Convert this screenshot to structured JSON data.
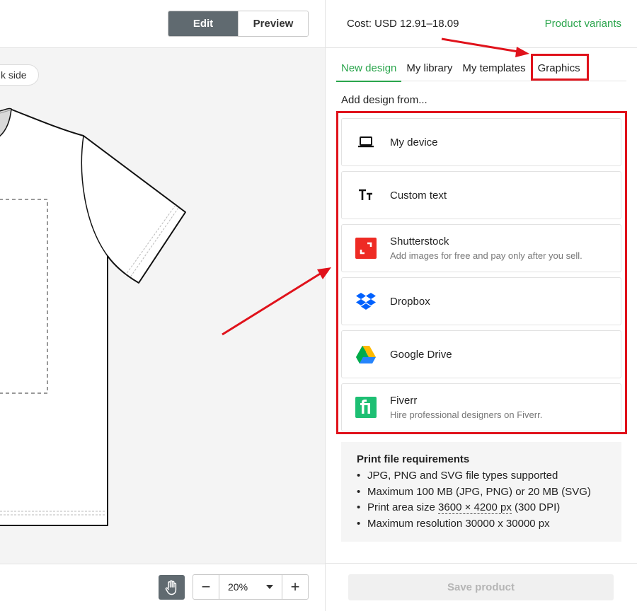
{
  "editor": {
    "edit_label": "Edit",
    "preview_label": "Preview",
    "side_label": "k side"
  },
  "zoom": {
    "minus": "−",
    "value": "20%",
    "plus": "+"
  },
  "header": {
    "cost": "Cost: USD 12.91–18.09",
    "variants_link": "Product variants"
  },
  "tabs": [
    {
      "label": "New design",
      "active": true
    },
    {
      "label": "My library"
    },
    {
      "label": "My templates"
    },
    {
      "label": "Graphics"
    }
  ],
  "add_from_label": "Add design from...",
  "sources": [
    {
      "title": "My device",
      "subtitle": "",
      "icon": "laptop-icon"
    },
    {
      "title": "Custom text",
      "subtitle": "",
      "icon": "text-icon"
    },
    {
      "title": "Shutterstock",
      "subtitle": "Add images for free and pay only after you sell.",
      "icon": "shutterstock-icon"
    },
    {
      "title": "Dropbox",
      "subtitle": "",
      "icon": "dropbox-icon"
    },
    {
      "title": "Google Drive",
      "subtitle": "",
      "icon": "google-drive-icon"
    },
    {
      "title": "Fiverr",
      "subtitle": "Hire professional designers on Fiverr.",
      "icon": "fiverr-icon"
    }
  ],
  "requirements": {
    "title": "Print file requirements",
    "items": [
      "JPG, PNG and SVG file types supported",
      "Maximum 100 MB (JPG, PNG) or 20 MB (SVG)",
      "Print area size",
      "Maximum resolution 30000 x 30000 px"
    ],
    "print_size": "3600 × 4200 px",
    "print_dpi": " (300 DPI)"
  },
  "save_label": "Save product",
  "colors": {
    "accent_green": "#2aa54c",
    "highlight_red": "#e0121b",
    "button_dark": "#606a70"
  }
}
